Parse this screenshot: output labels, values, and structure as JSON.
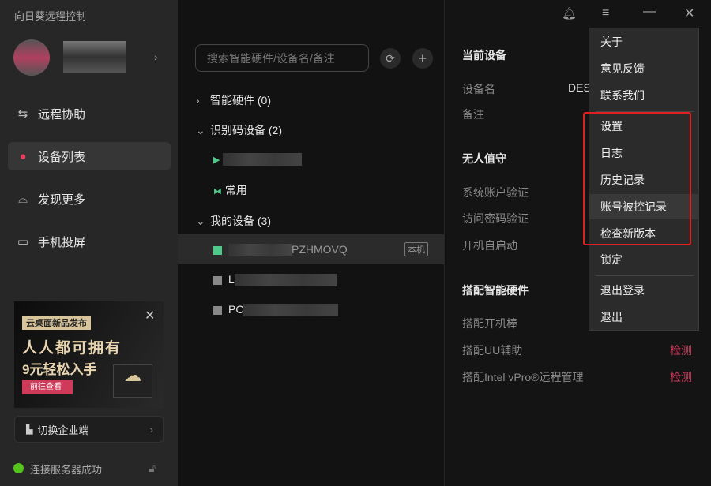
{
  "app": {
    "title": "向日葵远程控制"
  },
  "sidebar": {
    "items": [
      {
        "label": "远程协助",
        "icon": "remote-assist-icon"
      },
      {
        "label": "设备列表",
        "icon": "device-list-icon",
        "active": true
      },
      {
        "label": "发现更多",
        "icon": "discover-icon"
      },
      {
        "label": "手机投屏",
        "icon": "screen-cast-icon"
      }
    ],
    "ad": {
      "tag": "云桌面新品发布",
      "line1": "人人都可拥有",
      "line2": "9元轻松入手",
      "button": "前往查看"
    },
    "switch_enterprise": "切换企业端",
    "status": "连接服务器成功",
    "status_color": "#52c41a"
  },
  "middle": {
    "search_placeholder": "搜索智能硬件/设备名/备注",
    "groups": [
      {
        "label": "智能硬件 (0)",
        "expanded": false
      },
      {
        "label": "识别码设备 (2)",
        "expanded": true,
        "items": [
          "",
          "常用"
        ]
      },
      {
        "label": "我的设备 (3)",
        "expanded": true,
        "items": [
          {
            "name": "PZHMOVQ",
            "badge": "本机"
          },
          {
            "name": "L"
          },
          {
            "name": "PC"
          }
        ]
      }
    ]
  },
  "right": {
    "current_device": "当前设备",
    "device_name_label": "设备名",
    "device_name_value": "DES",
    "note_label": "备注",
    "unattended": "无人值守",
    "sys_account": "系统账户验证",
    "access_pwd": "访问密码验证",
    "autostart": "开机自启动",
    "hardware": "搭配智能硬件",
    "hw_items": [
      {
        "label": "搭配开机棒",
        "action": ""
      },
      {
        "label": "搭配UU辅助",
        "action": "检测"
      },
      {
        "label": "搭配Intel vPro®远程管理",
        "action": "检测"
      }
    ]
  },
  "menu": {
    "items": [
      "关于",
      "意见反馈",
      "联系我们",
      "设置",
      "日志",
      "历史记录",
      "账号被控记录",
      "检查新版本",
      "锁定",
      "退出登录",
      "退出"
    ],
    "highlight_color": "#e02020"
  }
}
